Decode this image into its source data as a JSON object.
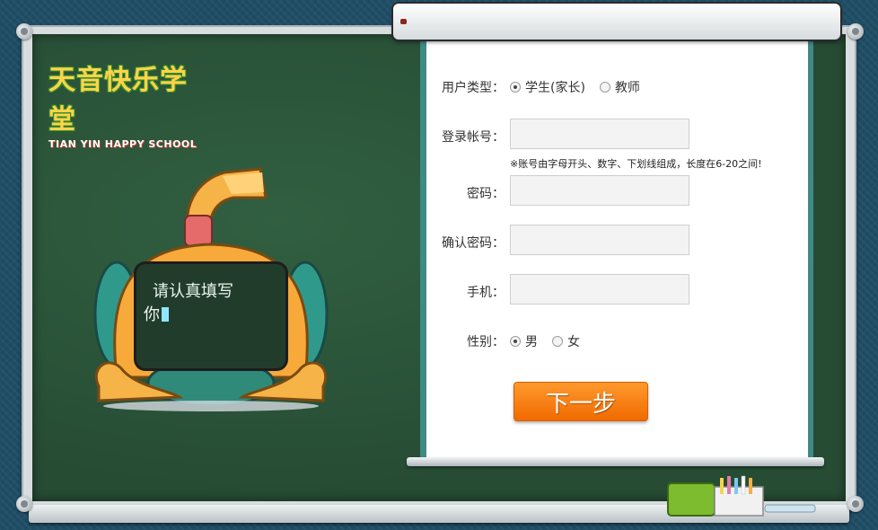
{
  "logo": {
    "chinese": "天音快乐学堂",
    "english": "TIAN YIN HAPPY SCHOOL"
  },
  "robot": {
    "line1": "请认真填写",
    "line2": "你"
  },
  "form": {
    "user_type": {
      "label": "用户类型：",
      "options": [
        "学生(家长)",
        "教师"
      ],
      "selected": "学生(家长)"
    },
    "account": {
      "label": "登录帐号：",
      "value": "",
      "hint": "※账号由字母开头、数字、下划线组成，长度在6-20之间!"
    },
    "password": {
      "label": "密码：",
      "value": ""
    },
    "confirm_password": {
      "label": "确认密码：",
      "value": ""
    },
    "phone": {
      "label": "手机：",
      "value": ""
    },
    "gender": {
      "label": "性别：",
      "options": [
        "男",
        "女"
      ],
      "selected": "男"
    },
    "next_button": "下一步"
  },
  "colors": {
    "board": "#2a5438",
    "accent": "#f07c10",
    "frame": "#d8dde0"
  }
}
